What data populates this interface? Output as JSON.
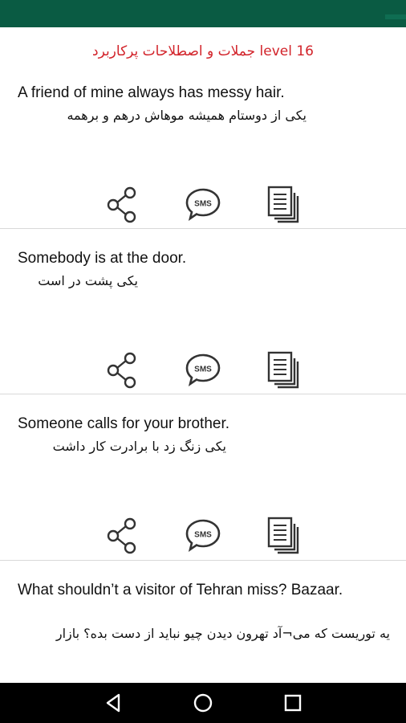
{
  "app": {
    "title": "جملات و اصطلاحات پرکاربرد level 16"
  },
  "cards": [
    {
      "english": "A friend of mine always has messy hair.",
      "persian": "یکی از دوستام همیشه موهاش درهم و برهمه"
    },
    {
      "english": "Somebody is at the door.",
      "persian": "یکی پشت در است"
    },
    {
      "english": "Someone calls for your brother.",
      "persian": "یکی زنگ زد با برادرت کار داشت"
    },
    {
      "english": "What shouldn’t a visitor of Tehran miss? Bazaar.",
      "persian": "یه توریست که می¬آد تهرون دیدن چیو نباید از دست بده؟ بازار"
    }
  ],
  "actions": {
    "share_icon": "share-icon",
    "sms_icon": "sms-icon",
    "sms_label": "SMS",
    "copy_icon": "copy-icon"
  },
  "navigation": {
    "back_icon": "back-icon",
    "home_icon": "home-icon",
    "recents_icon": "recents-icon"
  },
  "colors": {
    "status_bar": "#0a5b43",
    "title": "#d2232a",
    "icon": "#333333",
    "nav_bar": "#000000"
  }
}
